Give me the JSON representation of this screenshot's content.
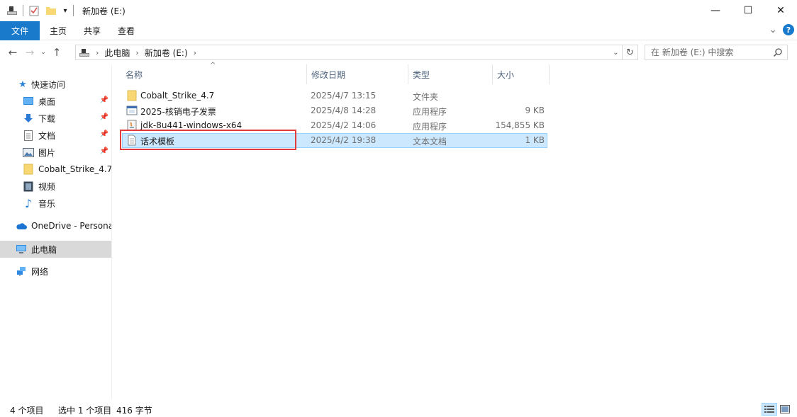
{
  "window": {
    "title": "新加卷 (E:)",
    "minimize": "—",
    "maximize": "☐",
    "close": "✕"
  },
  "ribbon": {
    "tabs": [
      "文件",
      "主页",
      "共享",
      "查看"
    ],
    "expand": "⌄",
    "help": "?"
  },
  "address": {
    "crumbs": [
      "此电脑",
      "新加卷 (E:)"
    ],
    "search_placeholder": "在 新加卷 (E:) 中搜索"
  },
  "nav": {
    "quick_access": "快速访问",
    "items": [
      {
        "label": "桌面",
        "icon": "desktop-icon",
        "pinned": true
      },
      {
        "label": "下载",
        "icon": "download-icon",
        "pinned": true
      },
      {
        "label": "文档",
        "icon": "document-icon",
        "pinned": true
      },
      {
        "label": "图片",
        "icon": "picture-icon",
        "pinned": true
      },
      {
        "label": "Cobalt_Strike_4.7",
        "icon": "folder-icon",
        "pinned": false
      },
      {
        "label": "视频",
        "icon": "video-icon",
        "pinned": false
      },
      {
        "label": "音乐",
        "icon": "music-icon",
        "pinned": false
      }
    ],
    "onedrive": "OneDrive - Persona",
    "this_pc": "此电脑",
    "network": "网络"
  },
  "columns": {
    "name": "名称",
    "date": "修改日期",
    "type": "类型",
    "size": "大小"
  },
  "files": [
    {
      "name": "Cobalt_Strike_4.7",
      "date": "2025/4/7 13:15",
      "type": "文件夹",
      "size": "",
      "icon": "folder-icon"
    },
    {
      "name": "2025-核销电子发票",
      "date": "2025/4/8 14:28",
      "type": "应用程序",
      "size": "9 KB",
      "icon": "app-icon"
    },
    {
      "name": "jdk-8u441-windows-x64",
      "date": "2025/4/2 14:06",
      "type": "应用程序",
      "size": "154,855 KB",
      "icon": "java-installer-icon"
    },
    {
      "name": "话术模板",
      "date": "2025/4/2 19:38",
      "type": "文本文档",
      "size": "1 KB",
      "icon": "text-file-icon"
    }
  ],
  "selected_index": 3,
  "status": {
    "count": "4 个项目",
    "selected": "选中 1 个项目",
    "size": "416 字节"
  },
  "colors": {
    "accent": "#1979ca",
    "selection": "#cce8ff",
    "highlight_box": "#e23b3b"
  }
}
